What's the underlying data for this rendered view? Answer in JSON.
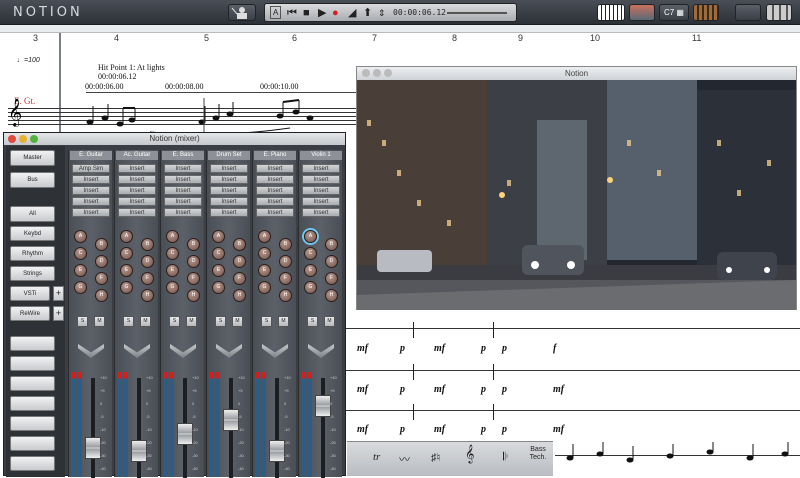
{
  "app": {
    "logo": "NOTION"
  },
  "toolbar": {
    "timecode": "00:00:06.12",
    "transport_label": "A"
  },
  "score": {
    "bar_numbers": [
      "3",
      "4",
      "5",
      "6",
      "7",
      "8",
      "9",
      "10",
      "11"
    ],
    "tempo": "♩=100",
    "hit_point": "Hit Point 1: At lights",
    "hit_time": "00:00:06.12",
    "timecodes": [
      "00:00:06.00",
      "00:00:08.00",
      "00:00:10.00"
    ],
    "instrument": "E. Gt.",
    "dynamics": [
      "mf",
      "p",
      "mf",
      "p",
      "p",
      "f",
      "mf",
      "p",
      "mf",
      "p",
      "p",
      "mf",
      "mf",
      "p",
      "mf",
      "p",
      "p",
      "mf"
    ]
  },
  "video": {
    "title": "Notion"
  },
  "palette": {
    "tr": "tr",
    "clef": "𝄞",
    "bass_tech": "Bass Tech."
  },
  "mixer": {
    "title": "Notion (mixer)",
    "left_buttons": [
      "Master",
      "Bus",
      "All",
      "Keybd",
      "Rhythm",
      "Strings",
      "VSTi",
      "ReWire"
    ],
    "channels": [
      {
        "name": "E. Guitar",
        "inserts": [
          "Amp Sim",
          "Insert",
          "Insert",
          "Insert",
          "Insert"
        ],
        "fader_level": 0.25
      },
      {
        "name": "Ac. Guitar",
        "inserts": [
          "Insert",
          "Insert",
          "Insert",
          "Insert",
          "Insert"
        ],
        "fader_level": 0.2
      },
      {
        "name": "E. Bass",
        "inserts": [
          "Insert",
          "Insert",
          "Insert",
          "Insert",
          "Insert"
        ],
        "fader_level": 0.42
      },
      {
        "name": "Drum Set",
        "inserts": [
          "Insert",
          "Insert",
          "Insert",
          "Insert",
          "Insert"
        ],
        "fader_level": 0.6
      },
      {
        "name": "E. Piano",
        "inserts": [
          "Insert",
          "Insert",
          "Insert",
          "Insert",
          "Insert"
        ],
        "fader_level": 0.2
      },
      {
        "name": "Violin 1",
        "inserts": [
          "Insert",
          "Insert",
          "Insert",
          "Insert",
          "Insert"
        ],
        "fader_level": 0.78
      }
    ],
    "send_labels": [
      "A",
      "B",
      "C",
      "D",
      "E",
      "F",
      "G",
      "H"
    ],
    "solo_label": "S",
    "mute_label": "M",
    "scale_labels": [
      "+10",
      "+5",
      "0",
      "-5",
      "-10",
      "-20",
      "-30",
      "-40"
    ]
  },
  "colors": {
    "accent_red": "#c0392b",
    "mixer_bg": "#3b3f45"
  }
}
